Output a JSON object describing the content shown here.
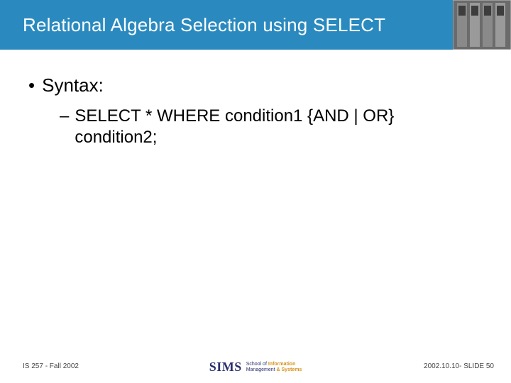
{
  "header": {
    "title": "Relational Algebra Selection using SELECT"
  },
  "content": {
    "bullet1_marker": "•",
    "bullet1_text": "Syntax:",
    "bullet2_marker": "–",
    "bullet2_text": "SELECT * WHERE condition1 {AND | OR} condition2;"
  },
  "footer": {
    "left": "IS 257 - Fall 2002",
    "right": "2002.10.10- SLIDE 50",
    "logo_main": "SIMS",
    "logo_line1a": "School of ",
    "logo_line1b": "Information",
    "logo_line2a": "Management ",
    "logo_line2b": "& Systems"
  }
}
